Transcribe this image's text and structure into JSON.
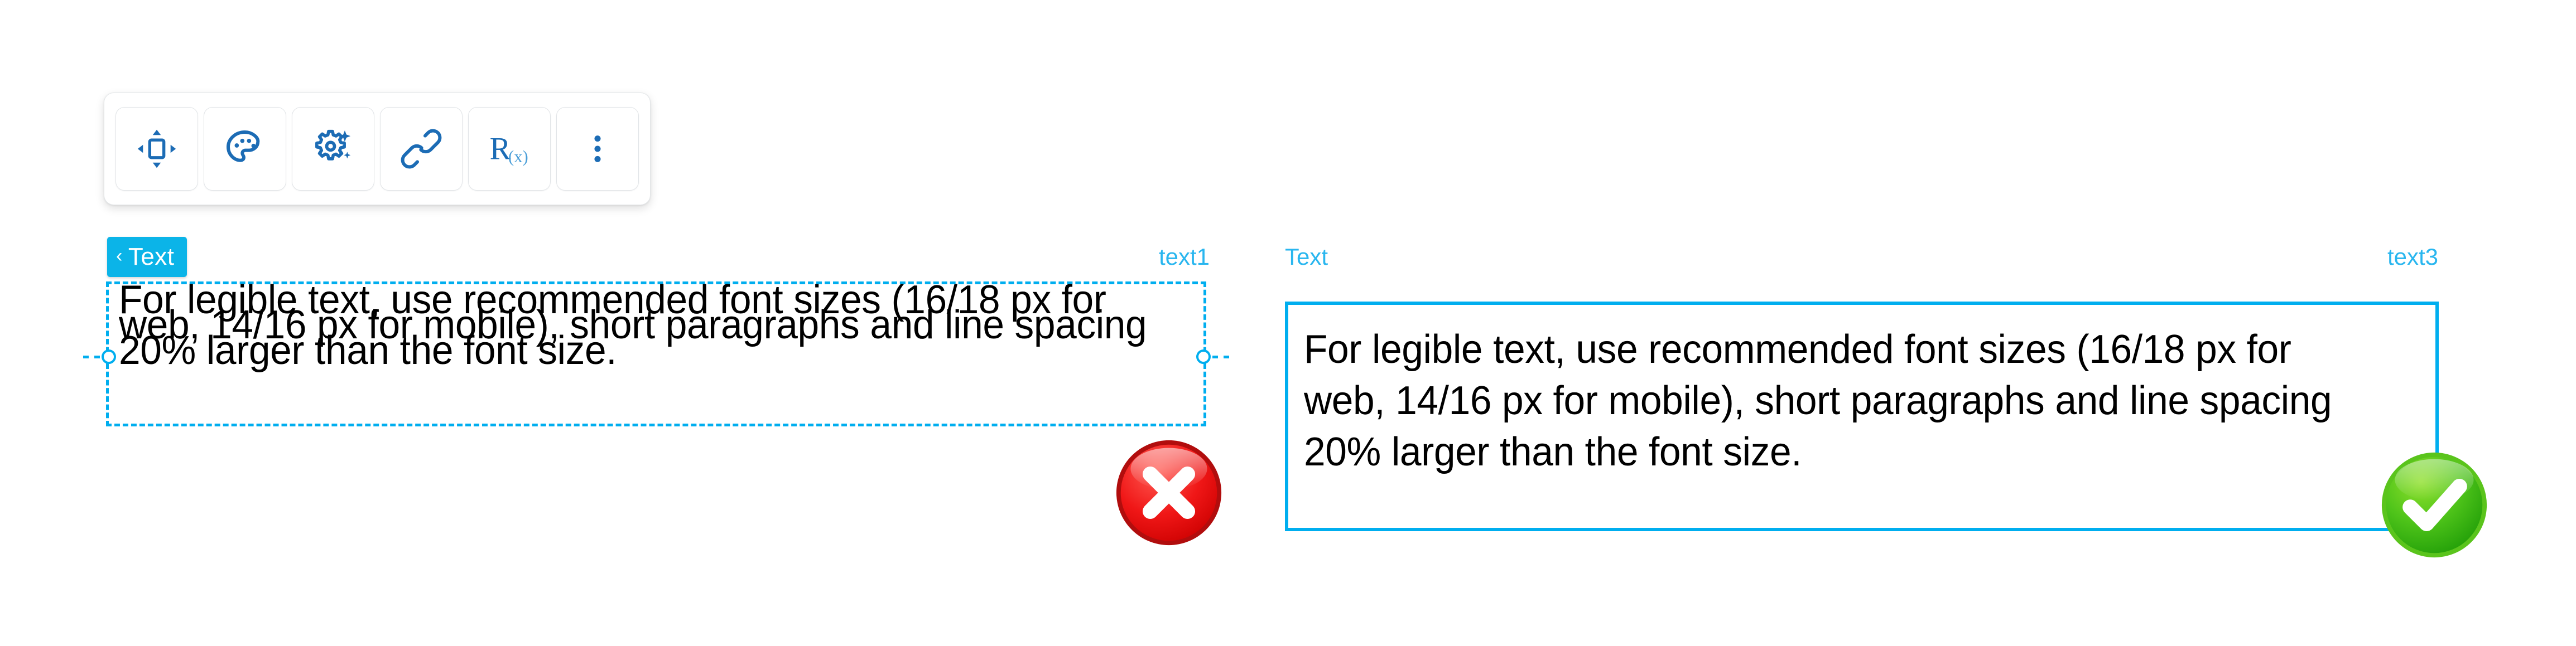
{
  "toolbar": {
    "buttons": [
      {
        "name": "move-resize-icon",
        "tooltip": "Position and size"
      },
      {
        "name": "palette-icon",
        "tooltip": "Style"
      },
      {
        "name": "gear-sparkle-icon",
        "tooltip": "Settings"
      },
      {
        "name": "link-icon",
        "tooltip": "Link"
      },
      {
        "name": "rx-formula-icon",
        "tooltip": "R(x) formula",
        "glyph": "R",
        "subscript": "(x)"
      },
      {
        "name": "more-vertical-icon",
        "tooltip": "More options"
      }
    ]
  },
  "bad_panel": {
    "badge_chevron": "‹",
    "badge_label": "Text",
    "element_id": "text1",
    "content": "For legible text, use recommended font sizes (16/18 px for web, 14/16 px for mobile), short paragraphs and line spacing 20% larger than the font size.",
    "status": "error"
  },
  "good_panel": {
    "label": "Text",
    "element_id": "text3",
    "content": "For legible text, use recommended font sizes (16/18 px for web, 14/16 px for mobile), short paragraphs and line spacing 20% larger than the font size.",
    "status": "ok"
  },
  "colors": {
    "accent_blue": "#00aeef",
    "badge_blue": "#0bb4e8",
    "label_blue": "#29b6ef",
    "icon_blue": "#1c6cb5",
    "error_red": "#e01b1b",
    "ok_green": "#47c018",
    "text_black": "#000000",
    "panel_border": "#e3e6e8"
  },
  "status_icons": {
    "error": {
      "name": "error-circle-x-icon",
      "glyph": "✖"
    },
    "ok": {
      "name": "success-circle-check-icon",
      "glyph": "✔"
    }
  }
}
